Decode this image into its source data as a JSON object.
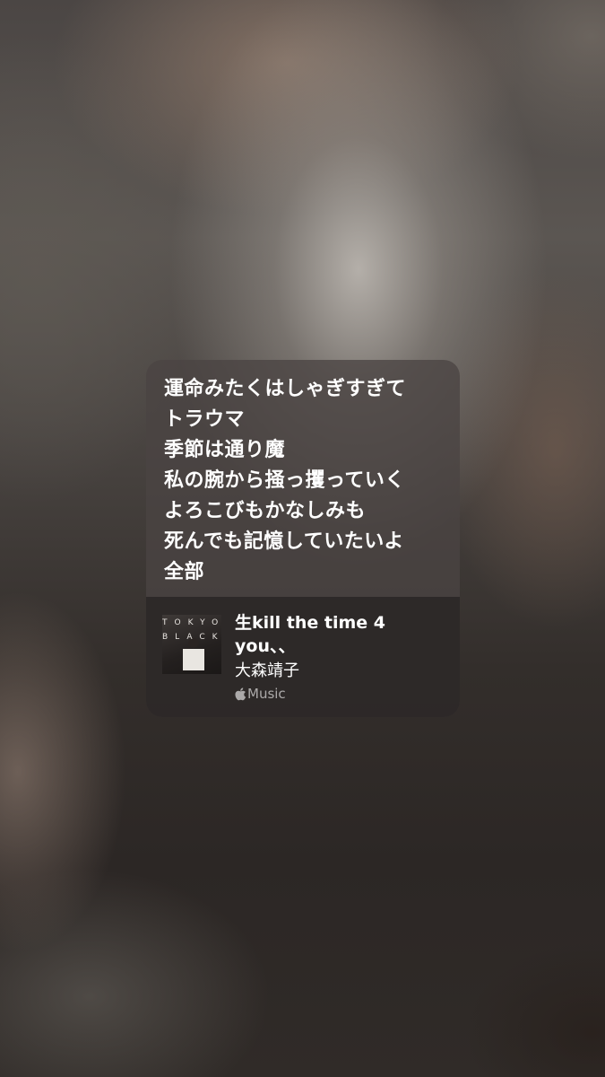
{
  "lyrics": [
    "運命みたくはしゃぎすぎて",
    "トラウマ",
    "季節は通り魔",
    "私の腕から掻っ攫っていく",
    "よろこびもかなしみも",
    "死んでも記憶していたいよ",
    "全部"
  ],
  "track": {
    "title": "生kill the time 4 you、、",
    "artist": "大森靖子",
    "service": "Music",
    "artwork_text": [
      "TOKYO",
      "BLACK"
    ]
  },
  "icons": {
    "service_logo": "apple-icon"
  }
}
